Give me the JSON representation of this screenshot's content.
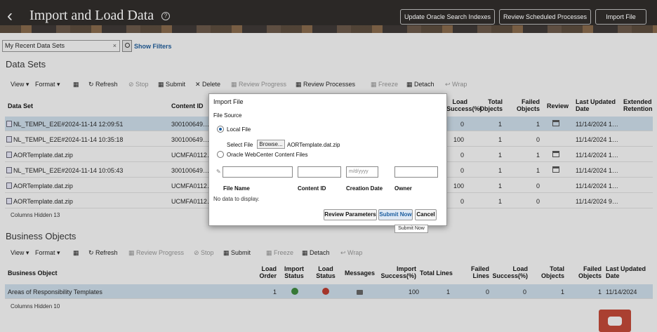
{
  "header": {
    "title": "Import and Load Data",
    "buttons": [
      "Update Oracle Search Indexes",
      "Review Scheduled Processes",
      "Import File"
    ]
  },
  "search": {
    "value": "My Recent Data Sets",
    "show_filters": "Show Filters"
  },
  "data_sets": {
    "title": "Data Sets",
    "toolbar": [
      "View",
      "Format",
      "Refresh",
      "Stop",
      "Submit",
      "Delete",
      "Review Progress",
      "Review Processes",
      "Freeze",
      "Detach",
      "Wrap"
    ],
    "columns": [
      "Data Set",
      "Content ID",
      "Load Success(%)",
      "Total Objects",
      "Failed Objects",
      "Review",
      "Last Updated Date",
      "Extended Retention"
    ],
    "rows": [
      {
        "name": "NL_TEMPL_E2E#2024-11-14 12:09:51",
        "content_id": "300100649…",
        "load": "0",
        "total": "1",
        "failed": "1",
        "date": "11/14/2024 1…"
      },
      {
        "name": "NL_TEMPL_E2E#2024-11-14 10:35:18",
        "content_id": "300100649…",
        "load": "100",
        "total": "1",
        "failed": "0",
        "date": "11/14/2024 1…"
      },
      {
        "name": "AORTemplate.dat.zip",
        "content_id": "UCMFA0112…",
        "load": "0",
        "total": "1",
        "failed": "1",
        "date": "11/14/2024 1…"
      },
      {
        "name": "NL_TEMPL_E2E#2024-11-14 10:05:43",
        "content_id": "300100649…",
        "load": "0",
        "total": "1",
        "failed": "1",
        "date": "11/14/2024 1…"
      },
      {
        "name": "AORTemplate.dat.zip",
        "content_id": "UCMFA0112…",
        "load": "100",
        "total": "1",
        "failed": "0",
        "date": "11/14/2024 1…"
      },
      {
        "name": "AORTemplate.dat.zip",
        "content_id": "UCMFA0112…",
        "load": "0",
        "total": "1",
        "failed": "0",
        "date": "11/14/2024 9…"
      }
    ],
    "columns_hidden": "Columns Hidden 13"
  },
  "business_objects": {
    "title": "Business Objects",
    "toolbar": [
      "View",
      "Format",
      "Refresh",
      "Review Progress",
      "Stop",
      "Submit",
      "Freeze",
      "Detach",
      "Wrap"
    ],
    "columns": [
      "Business Object",
      "Load Order",
      "Import Status",
      "Load Status",
      "Messages",
      "Import Success(%)",
      "Total Lines",
      "Failed Lines",
      "Load Success(%)",
      "Total Objects",
      "Failed Objects",
      "Last Updated Date"
    ],
    "row": {
      "name": "Areas of Responsibility Templates",
      "order": "1",
      "import_success": "100",
      "total_lines": "1",
      "failed_lines": "0",
      "load_success": "0",
      "total_objects": "1",
      "failed_objects": "1",
      "date": "11/14/2024"
    },
    "columns_hidden": "Columns Hidden 10"
  },
  "dialog": {
    "title": "Import File",
    "file_source": "File Source",
    "local_file": "Local File",
    "select_file": "Select File",
    "browse": "Browse...",
    "filename": "AORTemplate.dat.zip",
    "webcenter": "Oracle WebCenter Content Files",
    "date_placeholder": "m/d/yyyy",
    "columns": [
      "File Name",
      "Content ID",
      "Creation Date",
      "Owner"
    ],
    "no_data": "No data to display.",
    "buttons": [
      "Review Parameters",
      "Submit Now",
      "Cancel"
    ],
    "tooltip": "Submit Now"
  }
}
